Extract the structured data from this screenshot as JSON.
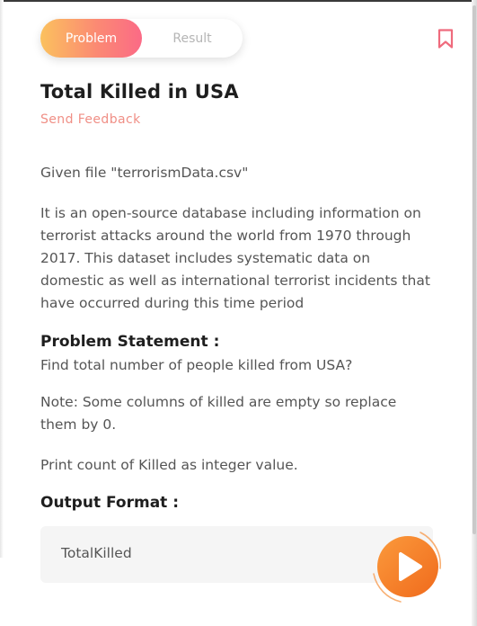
{
  "tabs": {
    "problem_label": "Problem",
    "result_label": "Result",
    "active": "Problem"
  },
  "bookmark": {
    "icon": "bookmark-icon"
  },
  "problem": {
    "title": "Total Killed in USA",
    "feedback_link": "Send Feedback",
    "file_line": "Given file \"terrorismData.csv\"",
    "description": "It is an open-source database including information on terrorist attacks around the world from 1970 through 2017. This dataset includes systematic data on domestic as well as international terrorist incidents that have occurred during this time period",
    "statement_heading": "Problem Statement :",
    "statement": "Find total number of people killed from USA?",
    "note": "Note: Some columns of killed are empty so replace them by 0.",
    "print_instruction": "Print count of Killed as integer value.",
    "output_heading": "Output Format :",
    "output_value": "TotalKilled"
  },
  "run_button": {
    "icon": "play-icon"
  },
  "colors": {
    "accent_start": "#fbc15e",
    "accent_end": "#fb6a86",
    "feedback": "#f08f86",
    "bookmark": "#ef6b7d",
    "run_button": "#f57f28"
  }
}
